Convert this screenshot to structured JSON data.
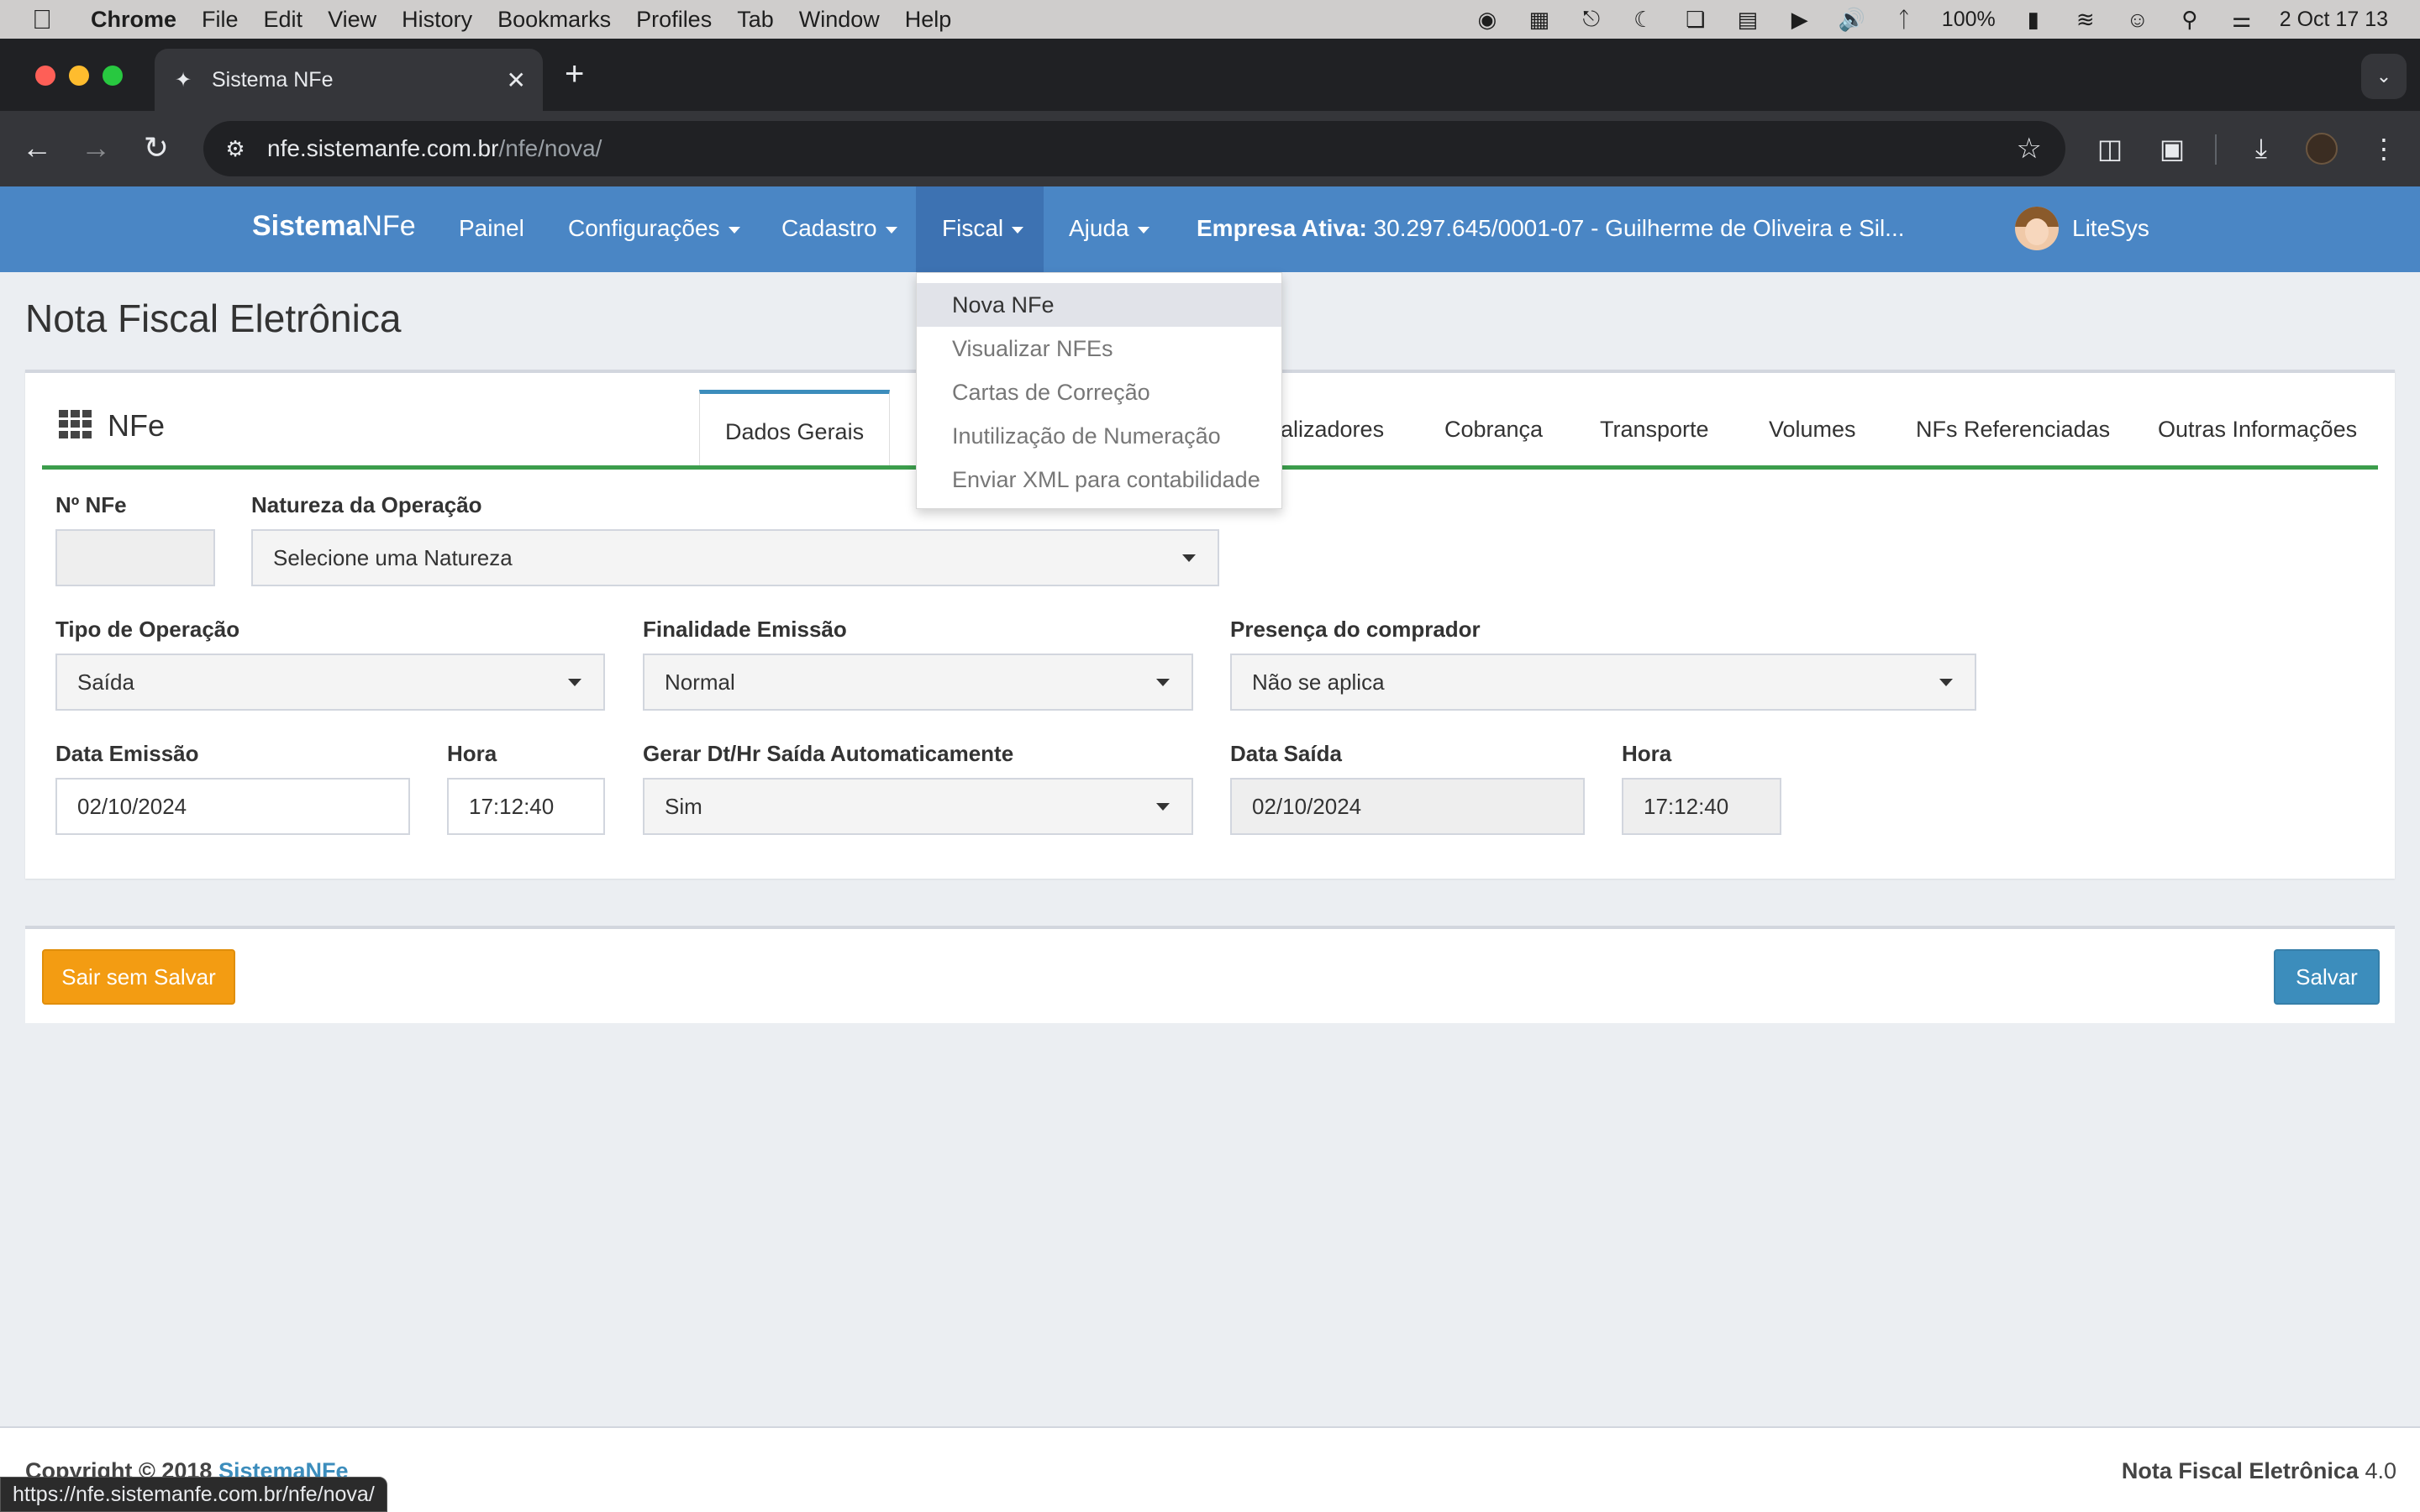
{
  "macos": {
    "menu": [
      "Chrome",
      "File",
      "Edit",
      "View",
      "History",
      "Bookmarks",
      "Profiles",
      "Tab",
      "Window",
      "Help"
    ],
    "battery": "100%",
    "datetime": "2 Oct  17 13"
  },
  "browser": {
    "tab_title": "Sistema NFe",
    "url_host": "nfe.sistemanfe.com.br",
    "url_path": "/nfe/nova/",
    "status_url": "https://nfe.sistemanfe.com.br/nfe/nova/"
  },
  "navbar": {
    "brand_bold": "Sistema",
    "brand_rest": "NFe",
    "links": [
      "Painel",
      "Configurações",
      "Cadastro",
      "Fiscal",
      "Ajuda"
    ],
    "empresa_label": "Empresa Ativa:",
    "empresa_value": "30.297.645/0001-07 - Guilherme de Oliveira e Sil...",
    "user": "LiteSys",
    "accent": "#4a86c5"
  },
  "fiscal_menu": {
    "items": [
      "Nova NFe",
      "Visualizar NFEs",
      "Cartas de Correção",
      "Inutilização de Numeração",
      "Enviar XML para contabilidade"
    ],
    "highlighted": "Nova NFe"
  },
  "page": {
    "title": "Nota Fiscal Eletrônica",
    "panel_title": "NFe",
    "tabs": [
      "Dados Gerais",
      "alizadores",
      "Cobrança",
      "Transporte",
      "Volumes",
      "NFs Referenciadas",
      "Outras Informações"
    ],
    "active_tab": "Dados Gerais"
  },
  "form": {
    "numero": {
      "label": "Nº NFe",
      "value": ""
    },
    "natureza": {
      "label": "Natureza da Operação",
      "value": "Selecione uma Natureza"
    },
    "tipo_operacao": {
      "label": "Tipo de Operação",
      "value": "Saída"
    },
    "finalidade": {
      "label": "Finalidade Emissão",
      "value": "Normal"
    },
    "presenca": {
      "label": "Presença do comprador",
      "value": "Não se aplica"
    },
    "data_emissao": {
      "label": "Data Emissão",
      "value": "02/10/2024"
    },
    "hora_emissao": {
      "label": "Hora",
      "value": "17:12:40"
    },
    "gerar_auto": {
      "label": "Gerar Dt/Hr Saída Automaticamente",
      "value": "Sim"
    },
    "data_saida": {
      "label": "Data Saída",
      "value": "02/10/2024"
    },
    "hora_saida": {
      "label": "Hora",
      "value": "17:12:40"
    }
  },
  "actions": {
    "exit_label": "Sair sem Salvar",
    "save_label": "Salvar"
  },
  "footer": {
    "copyright": "Copyright © 2018",
    "copyright_link": "SistemaNFe",
    "product": "Nota Fiscal Eletrônica",
    "version": "4.0"
  }
}
